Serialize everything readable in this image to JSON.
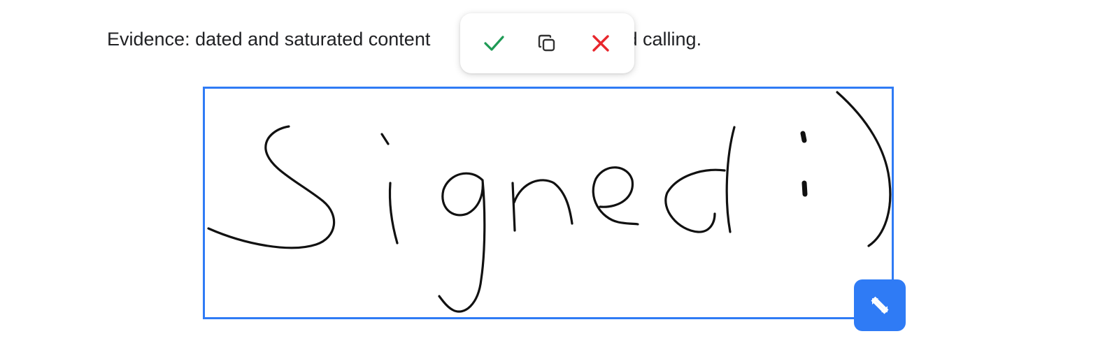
{
  "document": {
    "line_before": "Evidence: dated and saturated content",
    "line_after": "n agencies and cold calling."
  },
  "toolbar": {
    "buttons": [
      {
        "name": "confirm",
        "icon": "checkmark-icon",
        "color": "#1e9a55"
      },
      {
        "name": "duplicate",
        "icon": "copy-icon",
        "color": "#333333"
      },
      {
        "name": "delete",
        "icon": "close-icon",
        "color": "#e8262c"
      }
    ]
  },
  "signature": {
    "content": "Signed :)",
    "border_color": "#2f7bf5",
    "ink_color": "#111111"
  },
  "resize_handle": {
    "icon": "resize-icon",
    "color": "#2f7bf5"
  }
}
